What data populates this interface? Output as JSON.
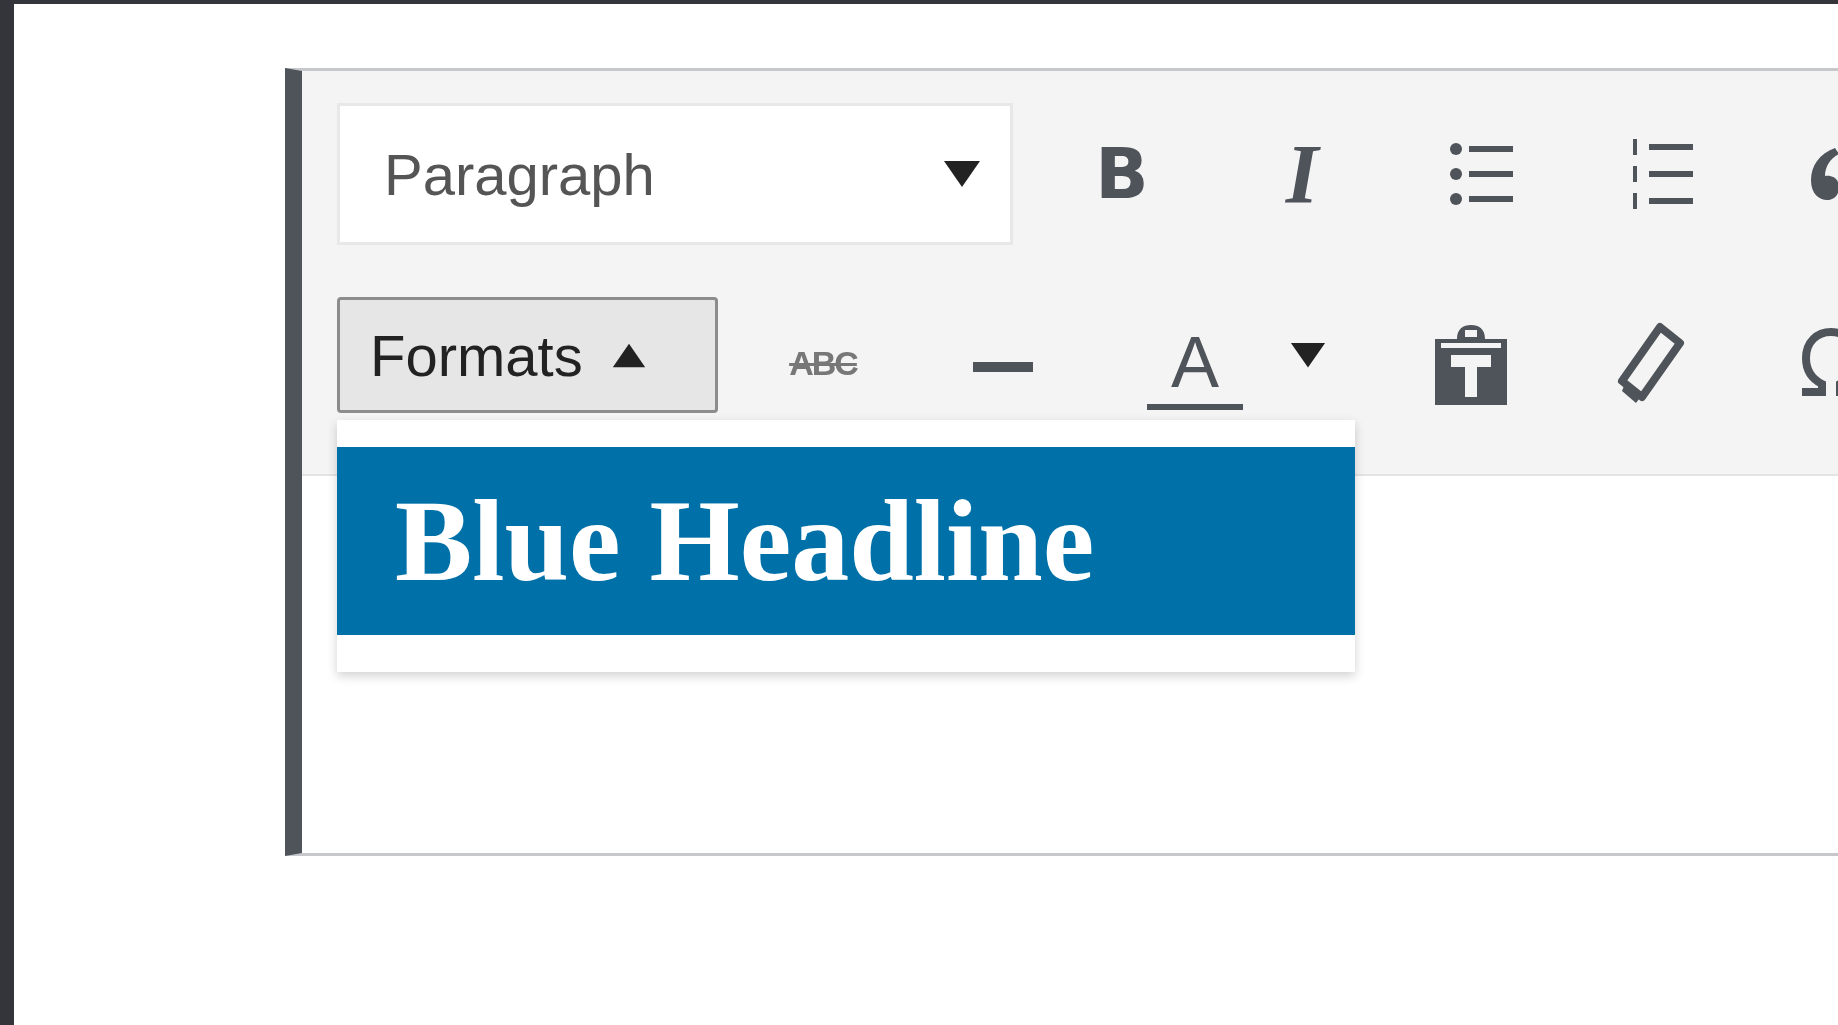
{
  "editor": {
    "toolbar": {
      "rows": [
        [
          {
            "kind": "block-select",
            "value": "Paragraph"
          },
          {
            "kind": "bold",
            "glyph": "B"
          },
          {
            "kind": "italic",
            "glyph": "I"
          },
          {
            "kind": "bullet-list"
          },
          {
            "kind": "numbered-list"
          },
          {
            "kind": "blockquote"
          }
        ],
        [
          {
            "kind": "formats-button",
            "label": "Formats",
            "expanded": true
          },
          {
            "kind": "strikethrough",
            "glyph": "ABC"
          },
          {
            "kind": "horizontal-rule"
          },
          {
            "kind": "text-color",
            "glyph": "A"
          },
          {
            "kind": "paste-text"
          },
          {
            "kind": "clear-formatting"
          },
          {
            "kind": "special-character"
          }
        ]
      ]
    },
    "formats_menu": {
      "items": [
        {
          "label": "Blue Headline",
          "selected": true
        }
      ]
    }
  }
}
